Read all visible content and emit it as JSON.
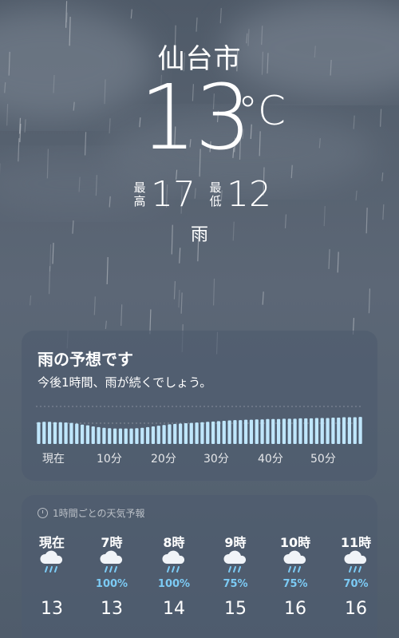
{
  "location": {
    "city": "仙台市"
  },
  "current": {
    "temperature": "13",
    "unit": "°C",
    "condition": "雨"
  },
  "high": {
    "label": "最高",
    "value": "17"
  },
  "low": {
    "label": "最低",
    "value": "12"
  },
  "precip_card": {
    "title": "雨の予想です",
    "subtitle": "今後1時間、雨が続くでしょう。",
    "ticks": [
      "現在",
      "10分",
      "20分",
      "30分",
      "40分",
      "50分"
    ],
    "intensity": [
      0.62,
      0.63,
      0.63,
      0.62,
      0.62,
      0.61,
      0.6,
      0.58,
      0.55,
      0.53,
      0.5,
      0.48,
      0.46,
      0.45,
      0.44,
      0.44,
      0.44,
      0.44,
      0.45,
      0.46,
      0.48,
      0.5,
      0.52,
      0.54,
      0.56,
      0.57,
      0.58,
      0.59,
      0.6,
      0.61,
      0.62,
      0.63,
      0.64,
      0.65,
      0.66,
      0.67,
      0.68,
      0.68,
      0.69,
      0.69,
      0.7,
      0.7,
      0.71,
      0.71,
      0.71,
      0.72,
      0.72,
      0.72,
      0.73,
      0.73,
      0.73,
      0.74,
      0.74,
      0.74,
      0.75,
      0.75,
      0.76,
      0.76,
      0.76,
      0.77
    ]
  },
  "hourly_card": {
    "header": "1時間ごとの天気予報",
    "hours": [
      {
        "label": "現在",
        "icon": "rain-cloud-icon",
        "pct": "",
        "temp": "13"
      },
      {
        "label": "7時",
        "icon": "rain-cloud-icon",
        "pct": "100%",
        "temp": "13"
      },
      {
        "label": "8時",
        "icon": "rain-cloud-icon",
        "pct": "100%",
        "temp": "14"
      },
      {
        "label": "9時",
        "icon": "rain-cloud-icon",
        "pct": "75%",
        "temp": "15"
      },
      {
        "label": "10時",
        "icon": "rain-cloud-icon",
        "pct": "75%",
        "temp": "16"
      },
      {
        "label": "11時",
        "icon": "rain-cloud-icon",
        "pct": "70%",
        "temp": "16"
      }
    ]
  },
  "colors": {
    "rain_accent": "#7ccbf5",
    "bar": "#bfe6fb"
  }
}
